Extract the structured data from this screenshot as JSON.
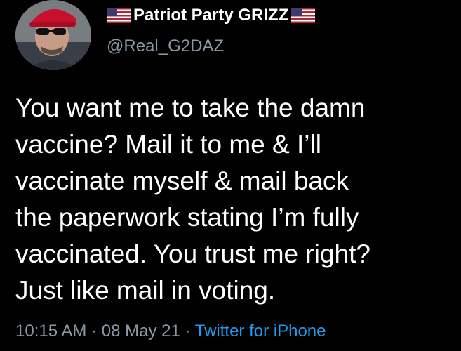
{
  "tweet": {
    "display_name": "Patriot Party GRIZZ",
    "handle": "@Real_G2DAZ",
    "name_icons": [
      "us-flag-icon",
      "us-flag-icon"
    ],
    "body_lines": [
      "You want me to take the damn",
      "vaccine? Mail it to me & I’ll",
      "vaccinate myself & mail back",
      "the paperwork stating I’m fully",
      "vaccinated. You trust me right?",
      "Just like mail in voting."
    ],
    "time": "10:15 AM",
    "separator": "·",
    "date": "08 May 21",
    "source": "Twitter for iPhone"
  },
  "colors": {
    "background": "#000000",
    "text_primary": "#ffffff",
    "text_secondary": "#8b98a5",
    "link": "#1d9bf0",
    "avatar_hat": "#c8102e"
  }
}
